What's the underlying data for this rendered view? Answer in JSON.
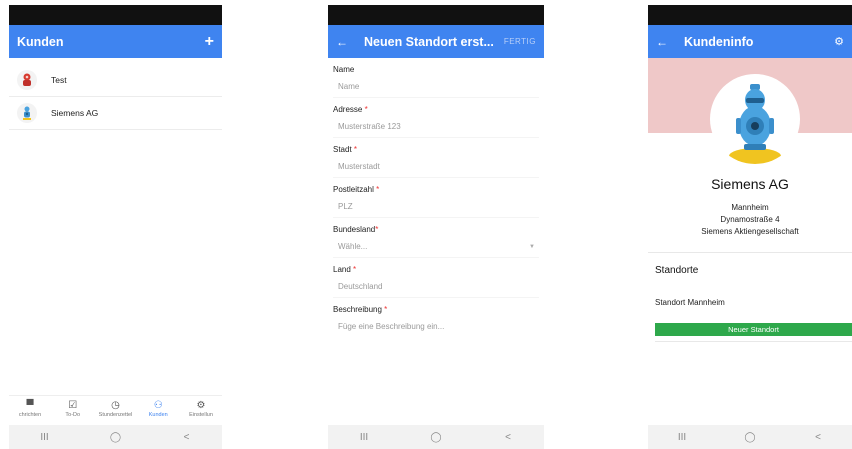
{
  "screen1": {
    "title": "Kunden",
    "add_label": "+",
    "customers": [
      {
        "name": "Test"
      },
      {
        "name": "Siemens AG"
      }
    ],
    "bottom_nav": [
      {
        "label": "chrichten",
        "icon": "chat-icon"
      },
      {
        "label": "To-Do",
        "icon": "checkbox-icon"
      },
      {
        "label": "Stundenzettel",
        "icon": "timer-icon"
      },
      {
        "label": "Kunden",
        "icon": "people-icon"
      },
      {
        "label": "Einstellun",
        "icon": "gear-icon"
      }
    ]
  },
  "screen2": {
    "title": "Neuen Standort erst...",
    "back_label": "←",
    "done_label": "FERTIG",
    "fields": [
      {
        "label": "Name",
        "required": "",
        "placeholder": "Name"
      },
      {
        "label": "Adresse",
        "required": " *",
        "placeholder": "Musterstraße 123"
      },
      {
        "label": "Stadt",
        "required": " *",
        "placeholder": "Musterstadt"
      },
      {
        "label": "Postleitzahl",
        "required": " *",
        "placeholder": "PLZ"
      },
      {
        "label": "Bundesland",
        "required": "*",
        "placeholder": "Wähle..."
      },
      {
        "label": "Land",
        "required": " *",
        "placeholder": "Deutschland"
      },
      {
        "label": "Beschreibung",
        "required": " *",
        "placeholder": "Füge eine Beschreibung ein..."
      }
    ]
  },
  "screen3": {
    "title": "Kundeninfo",
    "back_label": "←",
    "company": "Siemens AG",
    "city": "Mannheim",
    "street": "Dynamostraße 4",
    "legal_name": "Siemens Aktiengesellschaft",
    "section_title": "Standorte",
    "location": "Standort Mannheim",
    "new_location_button": "Neuer Standort"
  },
  "navbar": {
    "recents": "III",
    "home": "◯",
    "back": "<"
  },
  "colors": {
    "appbar": "#3f84f0",
    "hero": "#efc8c8",
    "button": "#2ea84b",
    "required": "#e33333"
  }
}
